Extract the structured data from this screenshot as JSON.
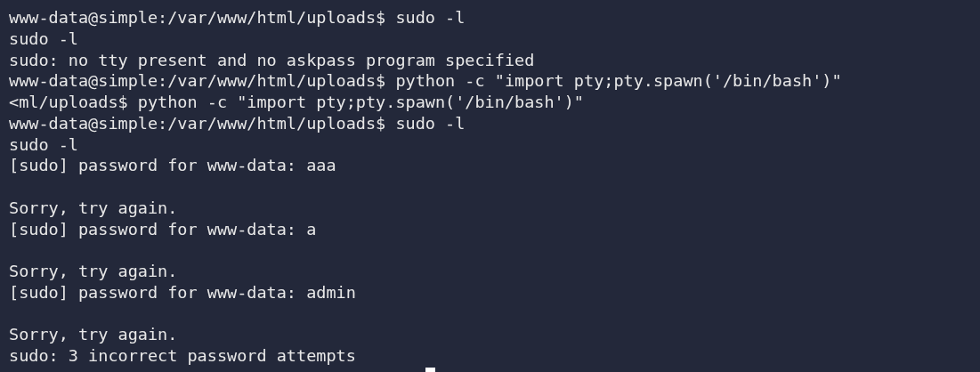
{
  "terminal": {
    "lines": [
      {
        "kind": "text",
        "text": "www-data@simple:/var/www/html/uploads$ sudo -l"
      },
      {
        "kind": "text",
        "text": "sudo -l"
      },
      {
        "kind": "text",
        "text": "sudo: no tty present and no askpass program specified"
      },
      {
        "kind": "text",
        "text": "www-data@simple:/var/www/html/uploads$ python -c \"import pty;pty.spawn('/bin/bash')\""
      },
      {
        "kind": "text",
        "text": "<ml/uploads$ python -c \"import pty;pty.spawn('/bin/bash')\""
      },
      {
        "kind": "text",
        "text": "www-data@simple:/var/www/html/uploads$ sudo -l"
      },
      {
        "kind": "text",
        "text": "sudo -l"
      },
      {
        "kind": "text",
        "text": "[sudo] password for www-data: aaa"
      },
      {
        "kind": "blank"
      },
      {
        "kind": "text",
        "text": "Sorry, try again."
      },
      {
        "kind": "text",
        "text": "[sudo] password for www-data: a"
      },
      {
        "kind": "blank"
      },
      {
        "kind": "text",
        "text": "Sorry, try again."
      },
      {
        "kind": "text",
        "text": "[sudo] password for www-data: admin"
      },
      {
        "kind": "blank"
      },
      {
        "kind": "text",
        "text": "Sorry, try again."
      },
      {
        "kind": "text",
        "text": "sudo: 3 incorrect password attempts"
      }
    ]
  }
}
